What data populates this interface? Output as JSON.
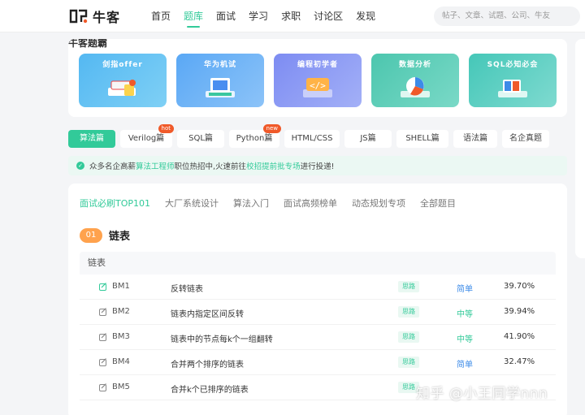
{
  "app": {
    "logo_text": "牛客"
  },
  "nav": {
    "items": [
      "首页",
      "题库",
      "面试",
      "学习",
      "求职",
      "讨论区",
      "发现"
    ],
    "active": "题库",
    "search_placeholder": "帖子、文章、试题、公司、牛友"
  },
  "banners": {
    "title": "牛客题霸",
    "items": [
      {
        "label": "剑指offer",
        "color1": "#54b8f2",
        "color2": "#7fd0f5"
      },
      {
        "label": "华为机试",
        "color1": "#5aa8f5",
        "color2": "#8cc3f8"
      },
      {
        "label": "编程初学者",
        "color1": "#7d8cf2",
        "color2": "#a3b0f7"
      },
      {
        "label": "数据分析",
        "color1": "#4cc6ae",
        "color2": "#7ad9c7"
      },
      {
        "label": "SQL必知必会",
        "color1": "#45c7b8",
        "color2": "#7fdad0"
      }
    ]
  },
  "tags": [
    {
      "label": "算法篇",
      "active": true,
      "badge": ""
    },
    {
      "label": "Verilog篇",
      "active": false,
      "badge": "hot"
    },
    {
      "label": "SQL篇",
      "active": false,
      "badge": ""
    },
    {
      "label": "Python篇",
      "active": false,
      "badge": "new"
    },
    {
      "label": "HTML/CSS",
      "active": false,
      "badge": ""
    },
    {
      "label": "JS篇",
      "active": false,
      "badge": ""
    },
    {
      "label": "SHELL篇",
      "active": false,
      "badge": ""
    },
    {
      "label": "语法篇",
      "active": false,
      "badge": ""
    },
    {
      "label": "名企真题",
      "active": false,
      "badge": ""
    }
  ],
  "notice": {
    "text_before": "众多名企高薪",
    "link1": "算法工程师",
    "text_mid": "职位热招中,火速前往",
    "link2": "校招提前批专场",
    "text_after": "进行投递!"
  },
  "subtabs": [
    "面试必刷TOP101",
    "大厂系统设计",
    "算法入门",
    "面试高频榜单",
    "动态规划专项",
    "全部题目"
  ],
  "section": {
    "num": "01",
    "title": "链表",
    "table_head": "链表"
  },
  "rows": [
    {
      "id": "BM1",
      "title": "反转链表",
      "tag": "思路",
      "difficulty": "简单",
      "rate": "39.70%",
      "level": "easy"
    },
    {
      "id": "BM2",
      "title": "链表内指定区间反转",
      "tag": "思路",
      "difficulty": "中等",
      "rate": "39.94%",
      "level": "mid"
    },
    {
      "id": "BM3",
      "title": "链表中的节点每k个一组翻转",
      "tag": "思路",
      "difficulty": "中等",
      "rate": "41.90%",
      "level": "mid"
    },
    {
      "id": "BM4",
      "title": "合并两个排序的链表",
      "tag": "思路",
      "difficulty": "简单",
      "rate": "32.47%",
      "level": "easy"
    },
    {
      "id": "BM5",
      "title": "合并k个已排序的链表",
      "tag": "思路",
      "difficulty": "",
      "rate": "",
      "level": "easy"
    }
  ],
  "watermark": "知乎 @小王同学nnn",
  "colors": {
    "accent": "#32ca99",
    "orange": "#ffa24d",
    "easy": "#3d8be8"
  }
}
